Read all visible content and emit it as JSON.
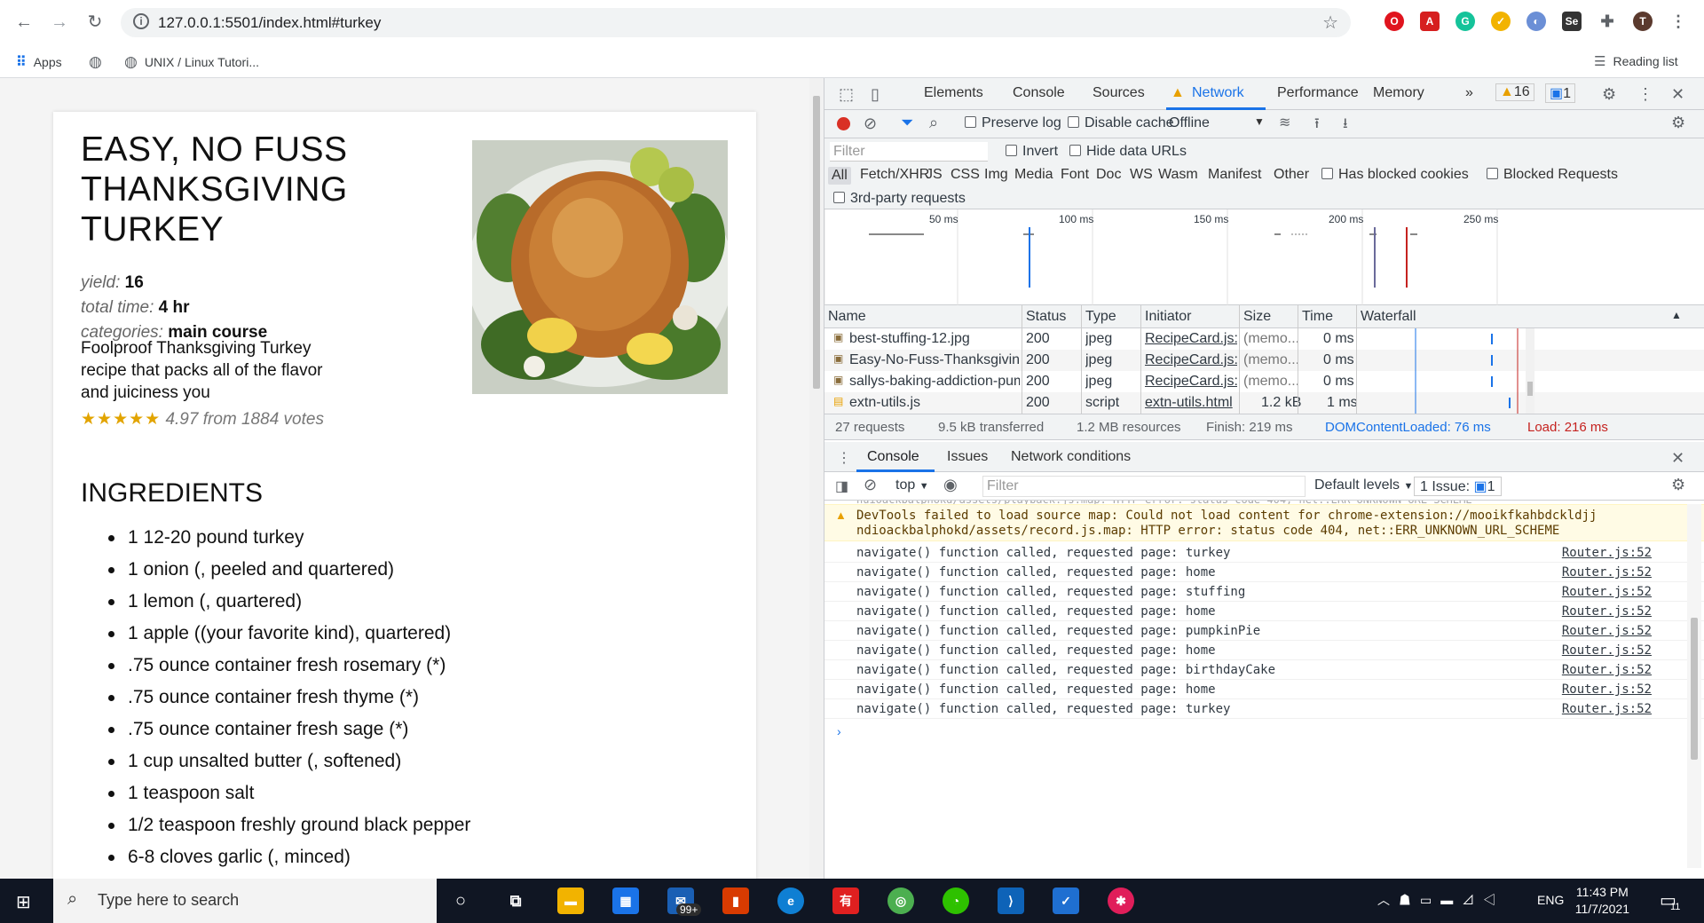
{
  "browser": {
    "url": "127.0.0.1:5501/index.html#turkey",
    "bookmarks": [
      "Apps",
      "UNIX / Linux Tutori..."
    ],
    "reading_list": "Reading list",
    "avatar_letter": "T"
  },
  "recipe": {
    "title": "EASY, NO FUSS THANKSGIVING TURKEY",
    "yield_label": "yield:",
    "yield": "16",
    "time_label": "total time:",
    "time": "4 hr",
    "categories_label": "categories:",
    "categories": "main course",
    "description": "Foolproof Thanksgiving Turkey recipe that packs all of the flavor and juiciness you",
    "stars": "★★★★★",
    "rating_text": "4.97 from 1884 votes",
    "ingredients_title": "INGREDIENTS",
    "ingredients": [
      "1 12-20 pound turkey",
      "1 onion (, peeled and quartered)",
      "1 lemon (, quartered)",
      "1 apple ((your favorite kind), quartered)",
      ".75 ounce container fresh rosemary (*)",
      ".75 ounce container fresh thyme (*)",
      ".75 ounce container fresh sage (*)",
      "1 cup unsalted butter (, softened)",
      "1 teaspoon salt",
      "1/2 teaspoon freshly ground black pepper",
      "6-8 cloves garlic (, minced)"
    ]
  },
  "devtools": {
    "tabs": [
      "Elements",
      "Console",
      "Sources",
      "Network",
      "Performance",
      "Memory"
    ],
    "warn_count": "16",
    "msg_count": "1",
    "network": {
      "preserve_log": "Preserve log",
      "disable_cache": "Disable cache",
      "throttle": "Offline",
      "filter_placeholder": "Filter",
      "invert": "Invert",
      "hide_data_urls": "Hide data URLs",
      "type_filters": [
        "All",
        "Fetch/XHR",
        "JS",
        "CSS",
        "Img",
        "Media",
        "Font",
        "Doc",
        "WS",
        "Wasm",
        "Manifest",
        "Other"
      ],
      "has_blocked_cookies": "Has blocked cookies",
      "blocked_requests": "Blocked Requests",
      "third_party": "3rd-party requests",
      "timeline_ticks": [
        "50 ms",
        "100 ms",
        "150 ms",
        "200 ms",
        "250 ms"
      ],
      "columns": [
        "Name",
        "Status",
        "Type",
        "Initiator",
        "Size",
        "Time",
        "Waterfall"
      ],
      "rows": [
        {
          "name": "best-stuffing-12.jpg",
          "status": "200",
          "type": "jpeg",
          "initiator": "RecipeCard.js:1...",
          "size": "(memo...",
          "time": "0 ms"
        },
        {
          "name": "Easy-No-Fuss-Thanksgiving-T...",
          "status": "200",
          "type": "jpeg",
          "initiator": "RecipeCard.js:1...",
          "size": "(memo...",
          "time": "0 ms"
        },
        {
          "name": "sallys-baking-addiction-pump...",
          "status": "200",
          "type": "jpeg",
          "initiator": "RecipeCard.js:1...",
          "size": "(memo...",
          "time": "0 ms"
        },
        {
          "name": "extn-utils.js",
          "status": "200",
          "type": "script",
          "initiator": "extn-utils.html",
          "size": "1.2 kB",
          "time": "1 ms"
        }
      ],
      "summary": {
        "requests": "27 requests",
        "transferred": "9.5 kB transferred",
        "resources": "1.2 MB resources",
        "finish": "Finish: 219 ms",
        "dcl": "DOMContentLoaded: 76 ms",
        "load": "Load: 216 ms"
      }
    },
    "drawer": {
      "tabs": [
        "Console",
        "Issues",
        "Network conditions"
      ],
      "context": "top",
      "filter_placeholder": "Filter",
      "levels": "Default levels",
      "issues": "1 Issue:",
      "issues_count": "1",
      "warning": "DevTools failed to load source map: Could not load content for chrome-extension://mooikfkahbdckldjjndioackbalphokd/assets/record.js.map: HTTP error: status code 404, net::ERR_UNKNOWN_URL_SCHEME",
      "warning_line1": "DevTools failed to load source map: Could not load content for chrome-extension://mooikfkahbdckldjj",
      "warning_line2": "ndioackbalphokd/assets/record.js.map: HTTP error: status code 404, net::ERR_UNKNOWN_URL_SCHEME",
      "logs": [
        {
          "text": "navigate() function called, requested page: turkey",
          "src": "Router.js:52"
        },
        {
          "text": "navigate() function called, requested page: home",
          "src": "Router.js:52"
        },
        {
          "text": "navigate() function called, requested page: stuffing",
          "src": "Router.js:52"
        },
        {
          "text": "navigate() function called, requested page: home",
          "src": "Router.js:52"
        },
        {
          "text": "navigate() function called, requested page: pumpkinPie",
          "src": "Router.js:52"
        },
        {
          "text": "navigate() function called, requested page: home",
          "src": "Router.js:52"
        },
        {
          "text": "navigate() function called, requested page: birthdayCake",
          "src": "Router.js:52"
        },
        {
          "text": "navigate() function called, requested page: home",
          "src": "Router.js:52"
        },
        {
          "text": "navigate() function called, requested page: turkey",
          "src": "Router.js:52"
        }
      ]
    }
  },
  "taskbar": {
    "search_placeholder": "Type here to search",
    "mail_badge": "99+",
    "lang": "ENG",
    "time": "11:43 PM",
    "date": "11/7/2021",
    "notif_count": "11"
  }
}
